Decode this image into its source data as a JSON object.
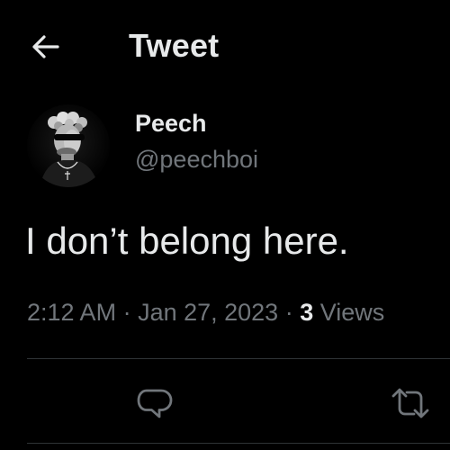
{
  "colors": {
    "background": "#000000",
    "primary_text": "#e7e9ea",
    "secondary_text": "#71767b",
    "divider": "#2f3336"
  },
  "header": {
    "back_icon": "arrow-left-icon",
    "title": "Tweet"
  },
  "tweet": {
    "author": {
      "display_name": "Peech",
      "handle": "@peechboi",
      "avatar": "profile-photo"
    },
    "text": "I don’t belong here.",
    "time": "2:12 AM",
    "separator_1": " · ",
    "date": "Jan 27, 2023",
    "separator_2": " · ",
    "views_count": "3",
    "views_label": " Views"
  },
  "actions": [
    {
      "name": "reply",
      "icon": "reply-bubble-icon"
    },
    {
      "name": "retweet",
      "icon": "retweet-icon"
    }
  ]
}
